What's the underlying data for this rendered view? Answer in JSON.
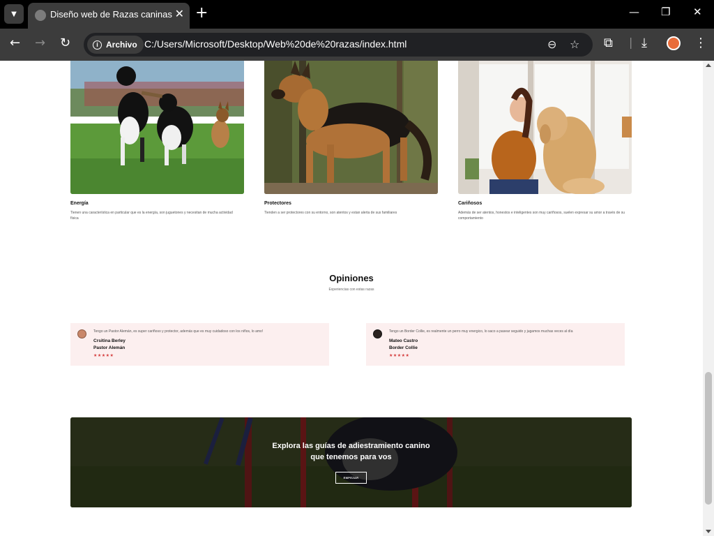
{
  "browser": {
    "tab_title": "Diseño web de Razas caninas",
    "chip_label": "Archivo",
    "url": "C:/Users/Microsoft/Desktop/Web%20de%20razas/index.html"
  },
  "features": [
    {
      "title": "Energía",
      "text": "Tienen una característica en particular que es la energía, son juguetones y necesitan de mucha actividad física"
    },
    {
      "title": "Protectores",
      "text": "Tienden a ser protectores con su entorno, son atentos y estan alerta de sus familiares"
    },
    {
      "title": "Cariñosos",
      "text": "Además de ser atentos, honestos e inteligentes son muy cariñosos, suelen expresar su amor a través de su comportamiento"
    }
  ],
  "opinions": {
    "title": "Opiniones",
    "subtitle": "Experiencias con estas razas",
    "reviews": [
      {
        "text": "Tengo un Pastor Alemán, es super cariñoso y protector, además que es muy cuidadoso con los niños, lo amo!",
        "name": "Crsitina Berley",
        "breed": "Pastor Alemán",
        "stars": "★★★★★"
      },
      {
        "text": "Tengo un Border Collie, es realmente un perro muy energico, lo saco a pasear seguido y jugamos muchas veces al día",
        "name": "Mateo Castro",
        "breed": "Border Collie",
        "stars": "★★★★★"
      }
    ]
  },
  "banner": {
    "title_line1": "Explora las guías de adiestramiento canino",
    "title_line2": "que tenemos para vos",
    "button": "EMPEZAR"
  }
}
